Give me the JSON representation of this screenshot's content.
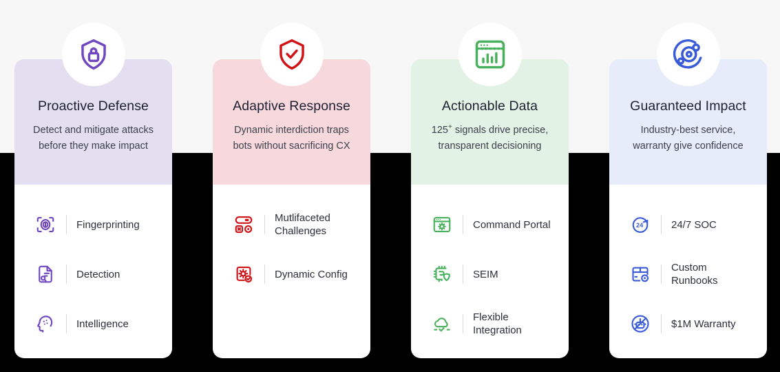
{
  "theme": {
    "background_top": "#f7f7f8",
    "background_bottom": "#000000",
    "card_background": "#ffffff",
    "title_color": "#1d2030",
    "body_color": "#3b3f4c"
  },
  "cards": [
    {
      "id": "proactive-defense",
      "title": "Proactive Defense",
      "description": "Detect and mitigate attacks before they make impact",
      "header_color": "#e3dff1",
      "accent_color": "#7046c0",
      "badge_icon": "shield-lock-icon",
      "features": [
        {
          "label": "Fingerprinting",
          "icon": "fingerprint-scan-icon"
        },
        {
          "label": "Detection",
          "icon": "document-search-icon"
        },
        {
          "label": "Intelligence",
          "icon": "head-intelligence-icon"
        }
      ]
    },
    {
      "id": "adaptive-response",
      "title": "Adaptive Response",
      "description": "Dynamic interdiction traps bots without sacrificing CX",
      "header_color": "#f7d9dd",
      "accent_color": "#d01217",
      "badge_icon": "shield-check-icon",
      "features": [
        {
          "label": "Mutlifaceted Challenges",
          "icon": "toggle-controls-icon"
        },
        {
          "label": "Dynamic Config",
          "icon": "gear-config-check-icon"
        }
      ]
    },
    {
      "id": "actionable-data",
      "title": "Actionable Data",
      "description_prefix": "125",
      "description_sup": "+",
      "description_suffix": " signals drive precise, transparent decisioning",
      "description": "125+ signals drive precise, transparent decisioning",
      "header_color": "#e2f2e5",
      "accent_color": "#49b15d",
      "badge_icon": "browser-bar-chart-icon",
      "features": [
        {
          "label": "Command Portal",
          "icon": "browser-gear-icon"
        },
        {
          "label": "SEIM",
          "icon": "chip-shield-icon"
        },
        {
          "label": "Flexible Integration",
          "icon": "cloud-check-icon"
        }
      ]
    },
    {
      "id": "guaranteed-impact",
      "title": "Guaranteed Impact",
      "description": "Industry-best service, warranty give confidence",
      "header_color": "#e6ecfa",
      "accent_color": "#3a5bd9",
      "badge_icon": "orbit-nodes-icon",
      "features": [
        {
          "label": "24/7 SOC",
          "icon": "clock-24-icon"
        },
        {
          "label": "Custom Runbooks",
          "icon": "box-gear-icon"
        },
        {
          "label": "$1M Warranty",
          "icon": "bot-blocked-icon"
        }
      ]
    }
  ]
}
